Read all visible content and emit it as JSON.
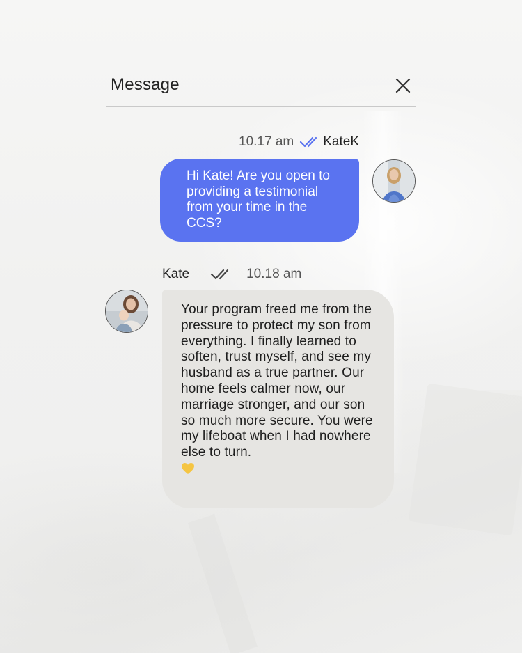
{
  "header": {
    "title": "Message"
  },
  "messages": {
    "sent": {
      "time": "10.17 am",
      "sender": "KateK",
      "text": "Hi Kate! Are you open to providing a testimonial from your time in the CCS?"
    },
    "received": {
      "sender": "Kate",
      "time": "10.18 am",
      "text": "Your program freed me from the pressure to protect my son from everything. I finally learned to soften, trust myself, and see my husband as a true partner. Our home feels calmer now, our marriage stronger, and our son so much more secure. You were my lifeboat when I had nowhere else to turn."
    }
  },
  "colors": {
    "sent_bubble": "#5a73f0",
    "received_bubble": "#e6e5e2",
    "read_ticks": "#5a73f0",
    "heart": "#f5c542"
  },
  "icons": {
    "close": "close-icon",
    "read_receipt": "double-check-icon",
    "emoji": "yellow-heart-icon"
  }
}
